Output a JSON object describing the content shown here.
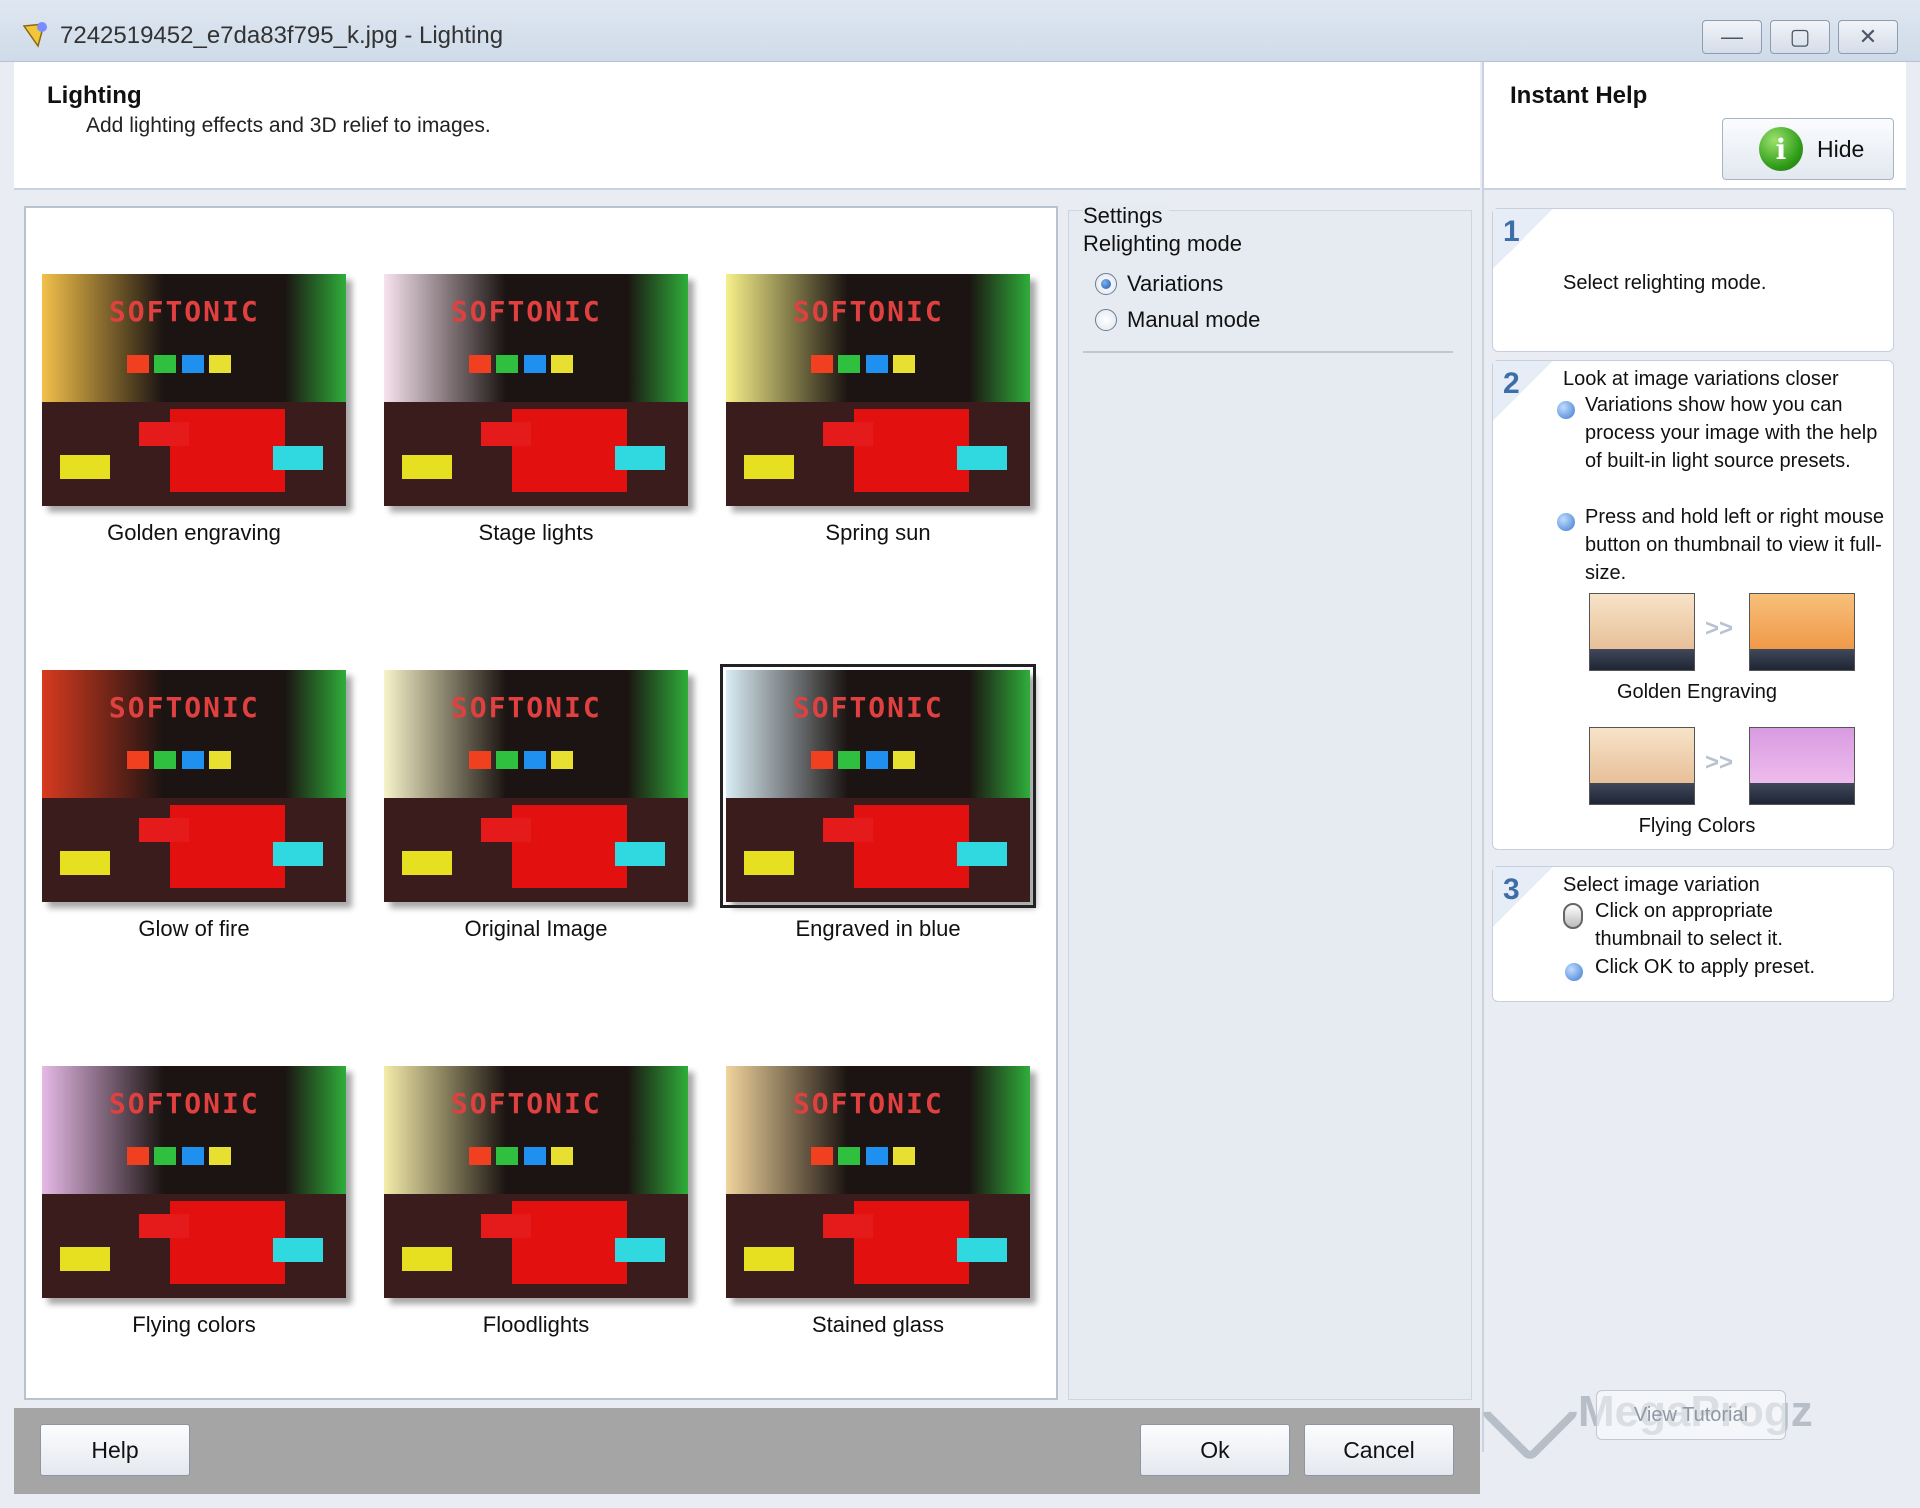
{
  "window": {
    "title": "7242519452_e7da83f795_k.jpg - Lighting",
    "minimize_label": "—",
    "maximize_label": "▢",
    "close_label": "✕"
  },
  "header": {
    "title": "Lighting",
    "subtitle": "Add lighting effects and 3D relief to images."
  },
  "help": {
    "title": "Instant Help",
    "hide_label": "Hide",
    "info_glyph": "i",
    "steps": [
      {
        "num": "1",
        "text": "Select relighting mode."
      },
      {
        "num": "2",
        "heading": "Look at image variations closer",
        "bullets": [
          "Variations show how you can process your image with the help of built-in light source presets.",
          "Press and hold left or right mouse button on thumbnail to view it full-size."
        ],
        "examples": [
          "Golden Engraving",
          "Flying Colors"
        ],
        "arrows": ">>"
      },
      {
        "num": "3",
        "heading": "Select image variation",
        "bullets": [
          "Click on appropriate thumbnail to select it.",
          "Click OK to apply preset."
        ]
      }
    ],
    "tutorial_label": "View Tutorial"
  },
  "watermark": "MegaProgz",
  "thumbnails": {
    "letters": "SOFTONIC",
    "items": [
      {
        "caption": "Golden engraving",
        "tint": "#f2c04a",
        "selected": false
      },
      {
        "caption": "Stage lights",
        "tint": "#f7e3ee",
        "selected": false
      },
      {
        "caption": "Spring sun",
        "tint": "#f6f08a",
        "selected": false
      },
      {
        "caption": "Glow of fire",
        "tint": "#d83a1f",
        "selected": false
      },
      {
        "caption": "Original Image",
        "tint": "#f7f3c9",
        "selected": false
      },
      {
        "caption": "Engraved in blue",
        "tint": "#d9ecf4",
        "selected": true
      },
      {
        "caption": "Flying colors",
        "tint": "#e6b9e6",
        "selected": false
      },
      {
        "caption": "Floodlights",
        "tint": "#f4eca9",
        "selected": false
      },
      {
        "caption": "Stained glass",
        "tint": "#f0d49c",
        "selected": false
      }
    ]
  },
  "settings": {
    "legend": "Settings",
    "mode_label": "Relighting mode",
    "options": [
      {
        "label": "Variations",
        "checked": true
      },
      {
        "label": "Manual mode",
        "checked": false
      }
    ]
  },
  "footer": {
    "help_label": "Help",
    "ok_label": "Ok",
    "cancel_label": "Cancel"
  }
}
